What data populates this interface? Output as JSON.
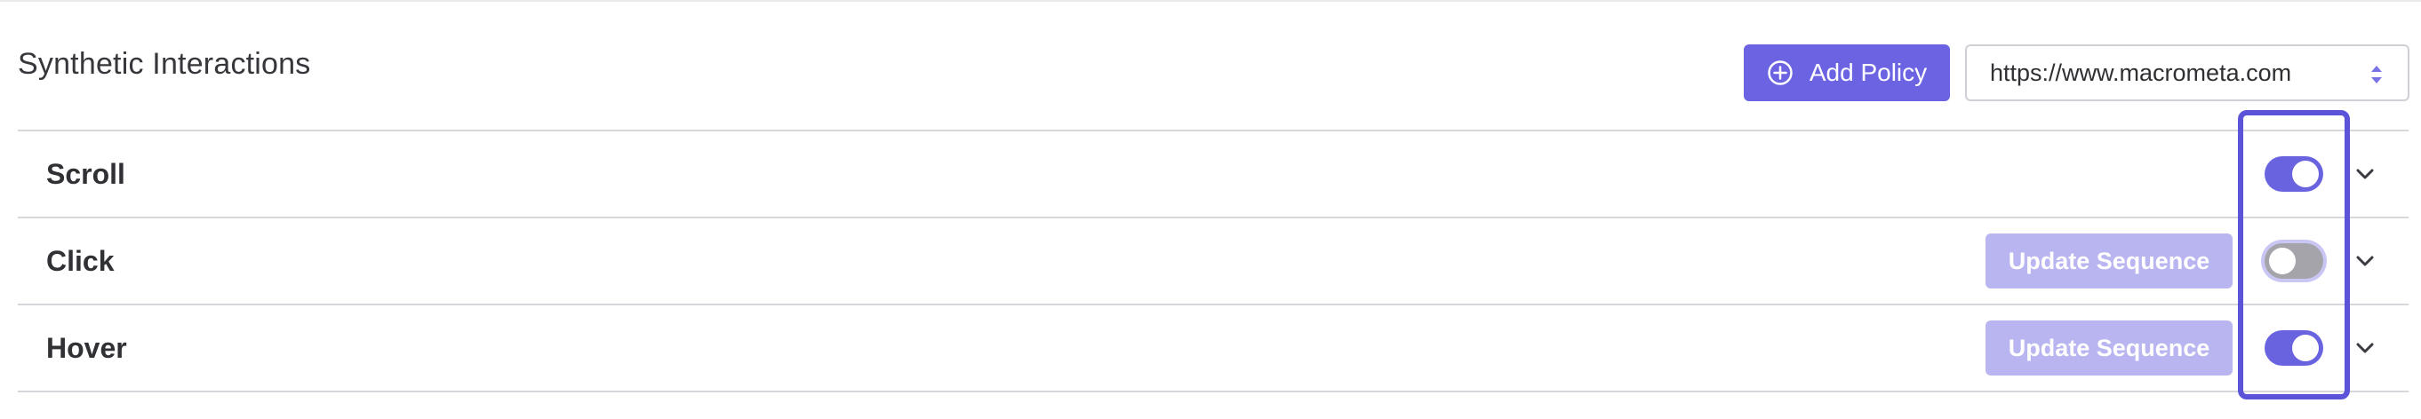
{
  "header": {
    "title": "Synthetic Interactions",
    "add_policy_label": "Add Policy",
    "url_select_value": "https://www.macrometa.com"
  },
  "interactions": [
    {
      "label": "Scroll",
      "enabled": true,
      "update_button_label": ""
    },
    {
      "label": "Click",
      "enabled": false,
      "update_button_label": "Update Sequence"
    },
    {
      "label": "Hover",
      "enabled": true,
      "update_button_label": "Update Sequence"
    }
  ],
  "icons": {
    "add": "plus-circle-icon",
    "select": "sort-arrows-icon",
    "expand": "chevron-down-icon"
  },
  "colors": {
    "accent": "#6c63e3",
    "accent_disabled": "#b9b5f1",
    "toggle_off": "#a4a4aa",
    "highlight": "#5c54d8"
  }
}
